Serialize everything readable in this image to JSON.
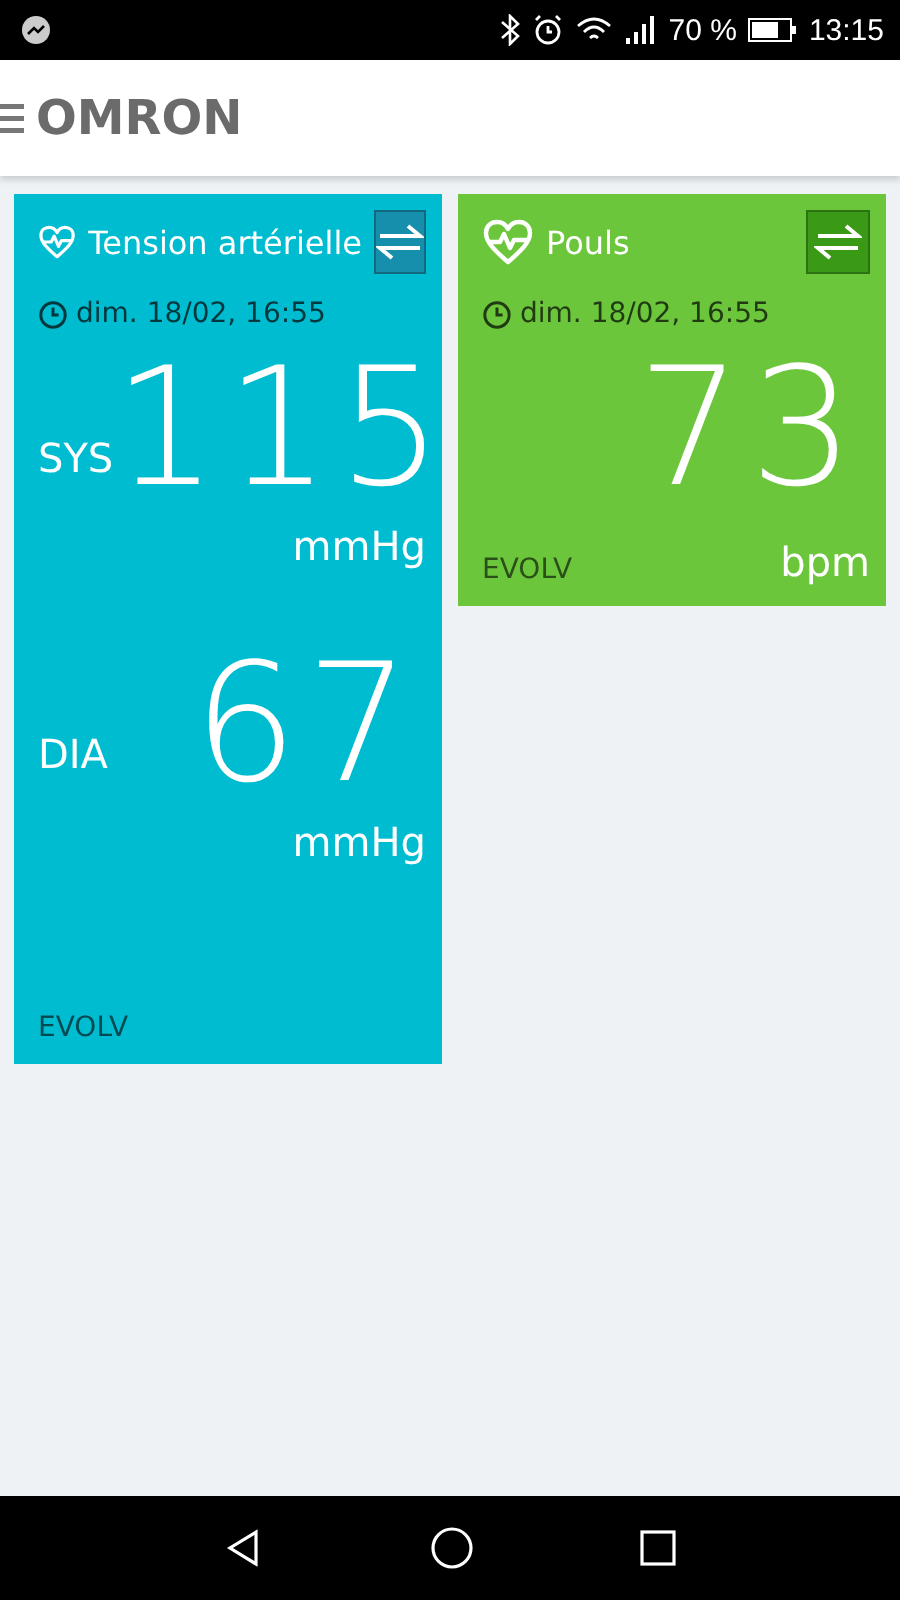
{
  "status_bar": {
    "battery": "70 %",
    "time": "13:15"
  },
  "header": {
    "logo": "OMRON"
  },
  "cards": [
    {
      "kind": "blood_pressure",
      "title": "Tension artérielle",
      "color": "#00bcd0",
      "date": "dim. 18/02, 16:55",
      "readings": [
        {
          "label": "SYS",
          "value": "115",
          "unit": "mmHg"
        },
        {
          "label": "DIA",
          "value": "67",
          "unit": "mmHg"
        }
      ],
      "device": "EVOLV"
    },
    {
      "kind": "pulse",
      "title": "Pouls",
      "color": "#6cc63c",
      "date": "dim. 18/02, 16:55",
      "readings": [
        {
          "value": "73",
          "unit": "bpm"
        }
      ],
      "device": "EVOLV"
    }
  ]
}
